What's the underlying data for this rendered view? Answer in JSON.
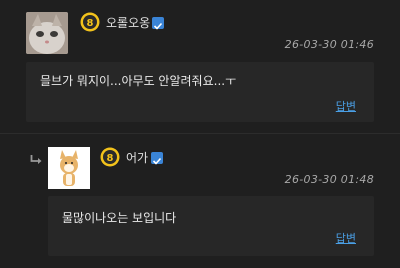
{
  "comments": [
    {
      "username": "오롤오옹",
      "level": "8",
      "timestamp": "26-03-30 01:46",
      "text": "믈브가 뭐지이...아무도 안알려줘요...ㅜ",
      "reply_label": "답변"
    },
    {
      "username": "어가",
      "level": "8",
      "timestamp": "26-03-30 01:48",
      "text": "물많이나오는 보입니다",
      "reply_label": "답변"
    }
  ],
  "colors": {
    "background": "#1f1f1f",
    "body_box": "#272727",
    "link": "#4a9fe5",
    "verified": "#3a84d6",
    "level_badge": "#f2c21b"
  },
  "icons": [
    "level-badge-icon",
    "verified-icon",
    "reply-arrow-icon"
  ]
}
